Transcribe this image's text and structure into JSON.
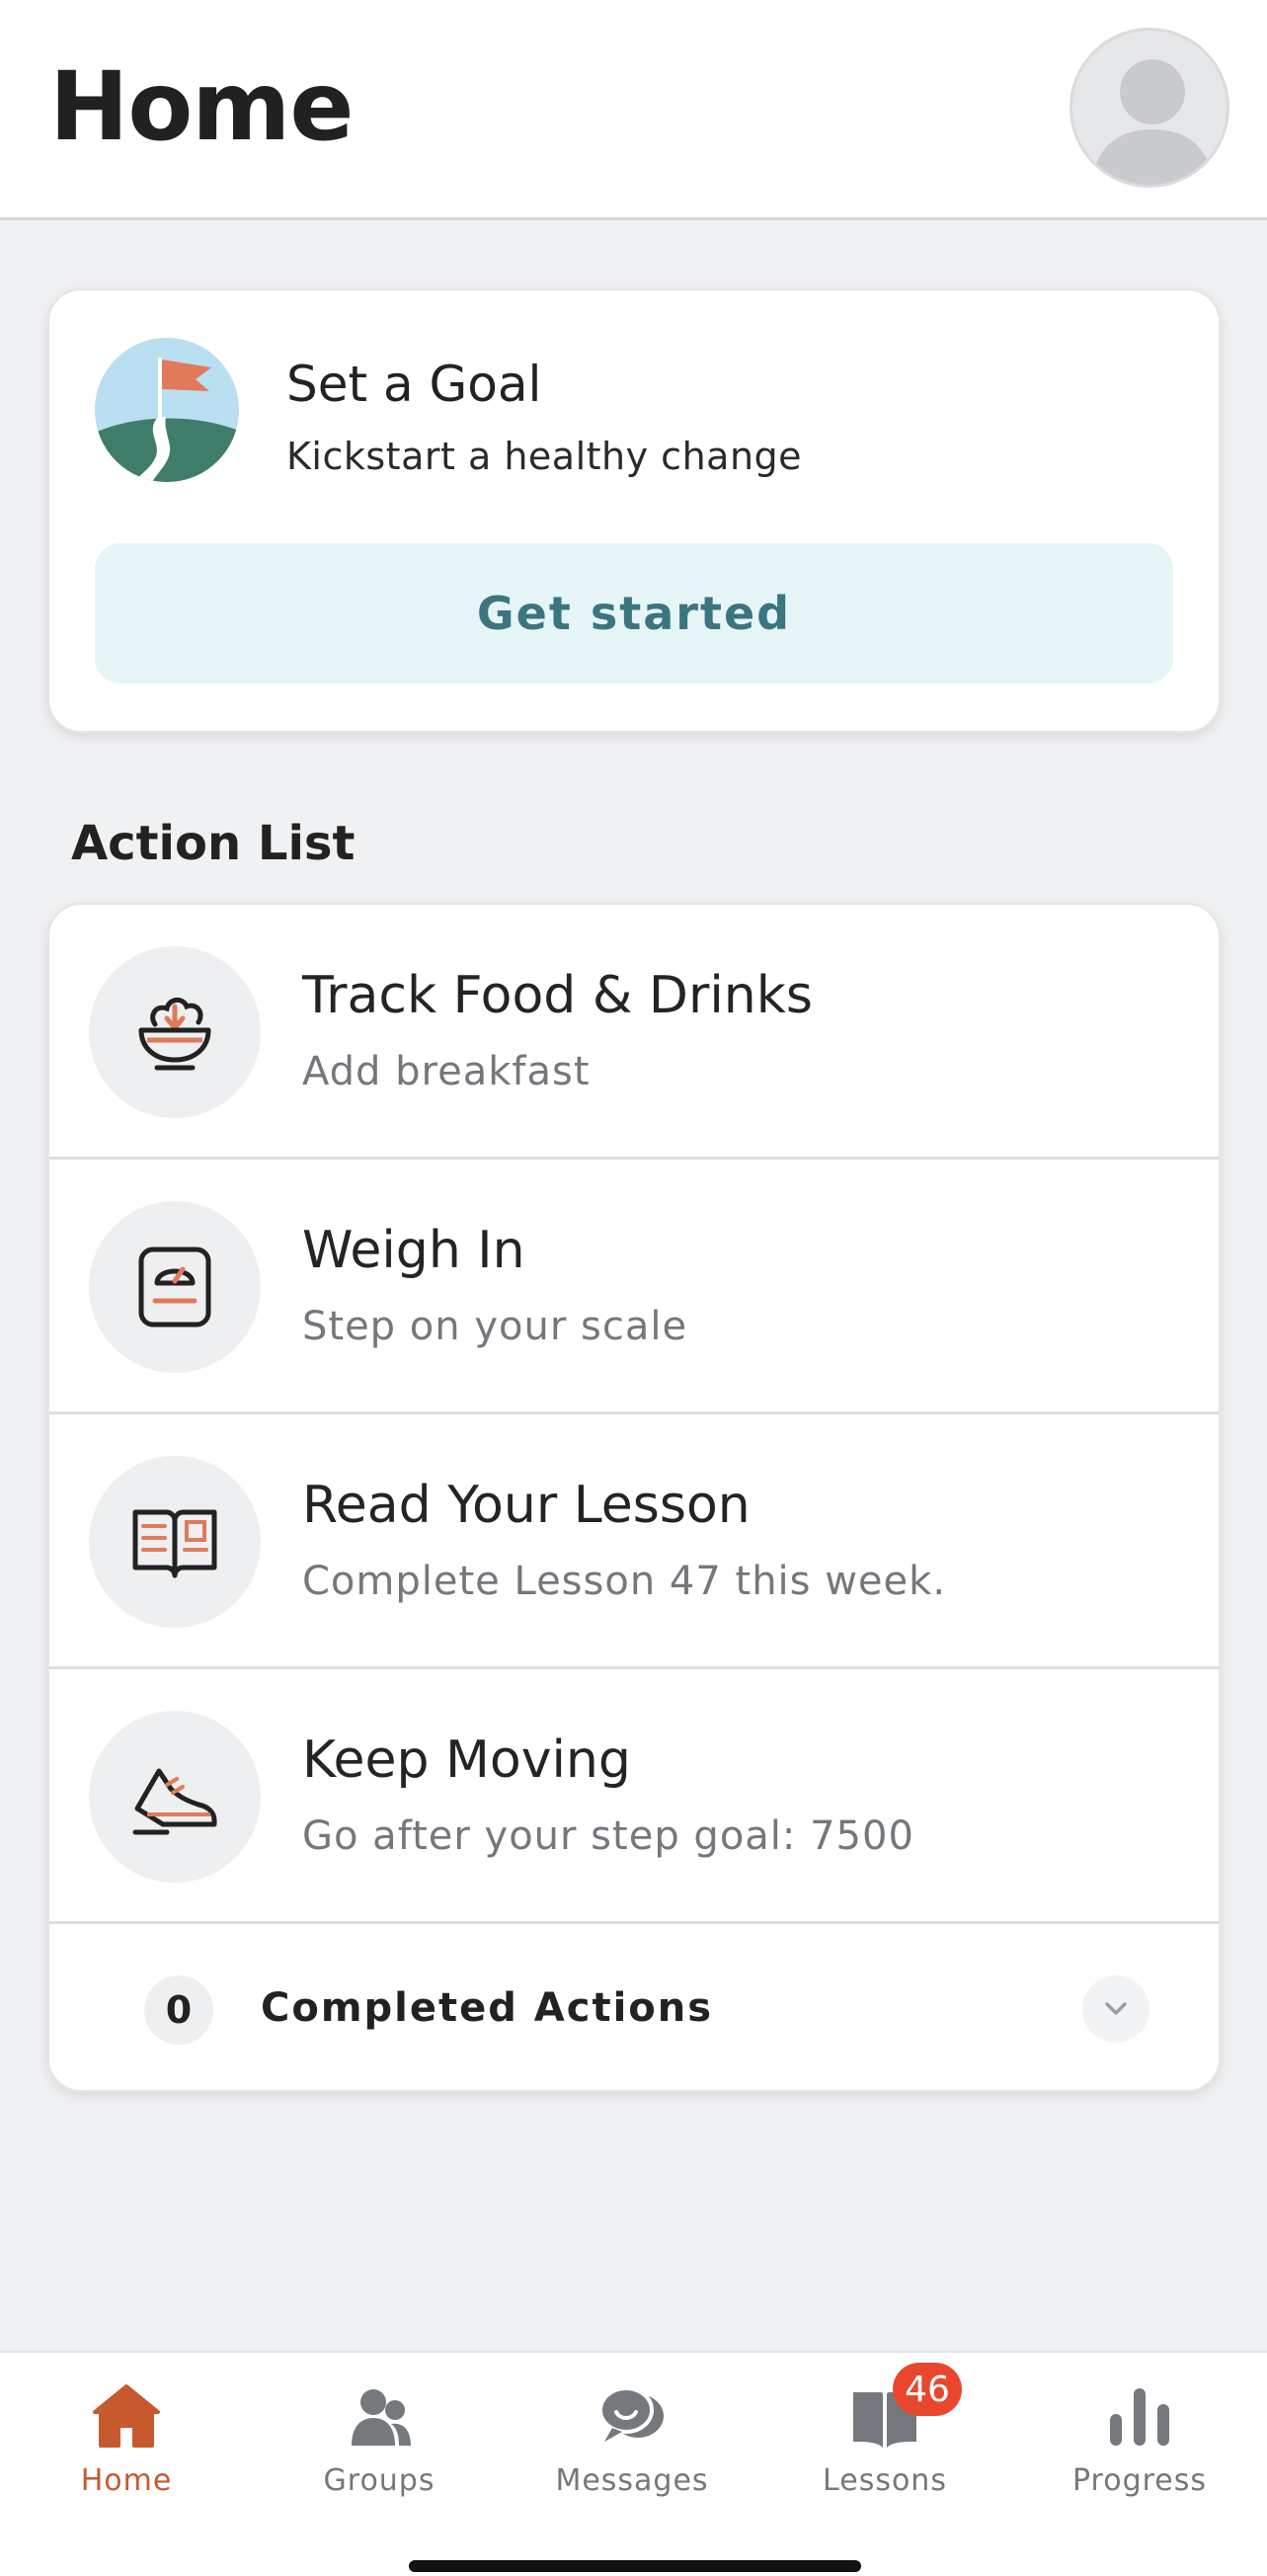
{
  "header": {
    "title": "Home"
  },
  "goal": {
    "title": "Set a Goal",
    "subtitle": "Kickstart a healthy change",
    "button_label": "Get started"
  },
  "action_list": {
    "title": "Action List",
    "items": [
      {
        "title": "Track Food & Drinks",
        "subtitle": "Add breakfast",
        "icon": "food-bowl-icon"
      },
      {
        "title": "Weigh In",
        "subtitle": "Step on your scale",
        "icon": "scale-icon"
      },
      {
        "title": "Read Your Lesson",
        "subtitle": "Complete Lesson 47 this week.",
        "icon": "book-icon"
      },
      {
        "title": "Keep Moving",
        "subtitle": "Go after your step goal: 7500",
        "icon": "sneaker-icon"
      }
    ],
    "completed": {
      "count": "0",
      "label": "Completed Actions"
    }
  },
  "tabs": [
    {
      "label": "Home",
      "icon": "home-icon",
      "active": true
    },
    {
      "label": "Groups",
      "icon": "groups-icon"
    },
    {
      "label": "Messages",
      "icon": "messages-icon"
    },
    {
      "label": "Lessons",
      "icon": "lessons-icon",
      "badge": "46"
    },
    {
      "label": "Progress",
      "icon": "progress-icon"
    }
  ],
  "colors": {
    "accent": "#c65a2e",
    "icon_orange": "#e07a5a",
    "button_bg": "#e6f5f6",
    "button_text": "#3a7580",
    "badge": "#e8472e"
  }
}
